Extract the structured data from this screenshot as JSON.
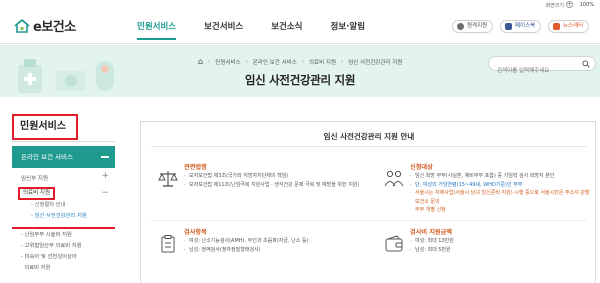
{
  "util": {
    "zoom_label": "화면크기",
    "zoom_plus": "+",
    "zoom_value": "100%"
  },
  "header": {
    "logo_text": "e보건소",
    "nav": [
      "민원서비스",
      "보건서비스",
      "보건소식",
      "정보·알림"
    ],
    "buttons": [
      "원격지원",
      "페이스북",
      "뉴스레터"
    ]
  },
  "banner": {
    "breadcrumb": [
      "민원서비스",
      "온라인 보건 서비스",
      "의료비 지원",
      "임신 사전건강관리 지원"
    ],
    "title": "임신 사전건강관리 지원",
    "search_placeholder": "검색어를 입력해주세요"
  },
  "sidebar": {
    "title": "민원서비스",
    "head": "온라인 보건 서비스",
    "items": [
      {
        "label": "임신부 지원",
        "toggle": "+"
      },
      {
        "label": "의료비 지원",
        "toggle": "−"
      }
    ],
    "subitems": [
      "신청절차 안내",
      "임신 사전건강관리 지원"
    ],
    "more": [
      "난임부부 시술비 지원",
      "고위험임산부 의료비 지원",
      "미숙아 및 선천성이상아",
      "의료비 지원"
    ]
  },
  "panel": {
    "title": "임신 사전건강관리 지원 안내",
    "sections": [
      {
        "title": "관련법령",
        "lines": [
          {
            "text": "모자보건법 제3조(국가와 지방자치단체의 책임)",
            "style": ""
          },
          {
            "text": "모자보건법 제11조(난임극복 지원사업 · 생식건강 문제 극복 및 예방을 위한 지원)",
            "style": "wrap"
          }
        ]
      },
      {
        "title": "신청대상",
        "lines": [
          {
            "text": "임신 희망 부부(사실혼, 예비부부 포함) 중 가임력 검사 희망자 본인",
            "style": ""
          },
          {
            "text": "단, 여성의 가임연령(15~49세, WHO기준)인 부부",
            "style": "blue"
          },
          {
            "text": "서울시는 자체사업(서울시 남녀 임신준비 지원) 시행 중으로 서울시민은 주소지 관할 보건소 문의",
            "style": "orange wrap"
          },
          {
            "text": "부부 개별 신청",
            "style": "orange"
          }
        ]
      },
      {
        "title": "검사항목",
        "lines": [
          {
            "text": "여성: 난소기능검사(AMH), 부인과 초음파(자궁, 난소 등)",
            "style": ""
          },
          {
            "text": "남성: 정액검사(정자정밀형태검사)",
            "style": ""
          }
        ]
      },
      {
        "title": "검사비 지원금액",
        "lines": [
          {
            "text": "여성: 최대 13만원",
            "style": ""
          },
          {
            "text": "남성: 최대 5만원",
            "style": ""
          }
        ]
      }
    ]
  },
  "colors": {
    "accent": "#1f9a8f",
    "highlight": "#e21c2c",
    "orange": "#d15b1d",
    "banner_bg": "#e3f3ef"
  }
}
